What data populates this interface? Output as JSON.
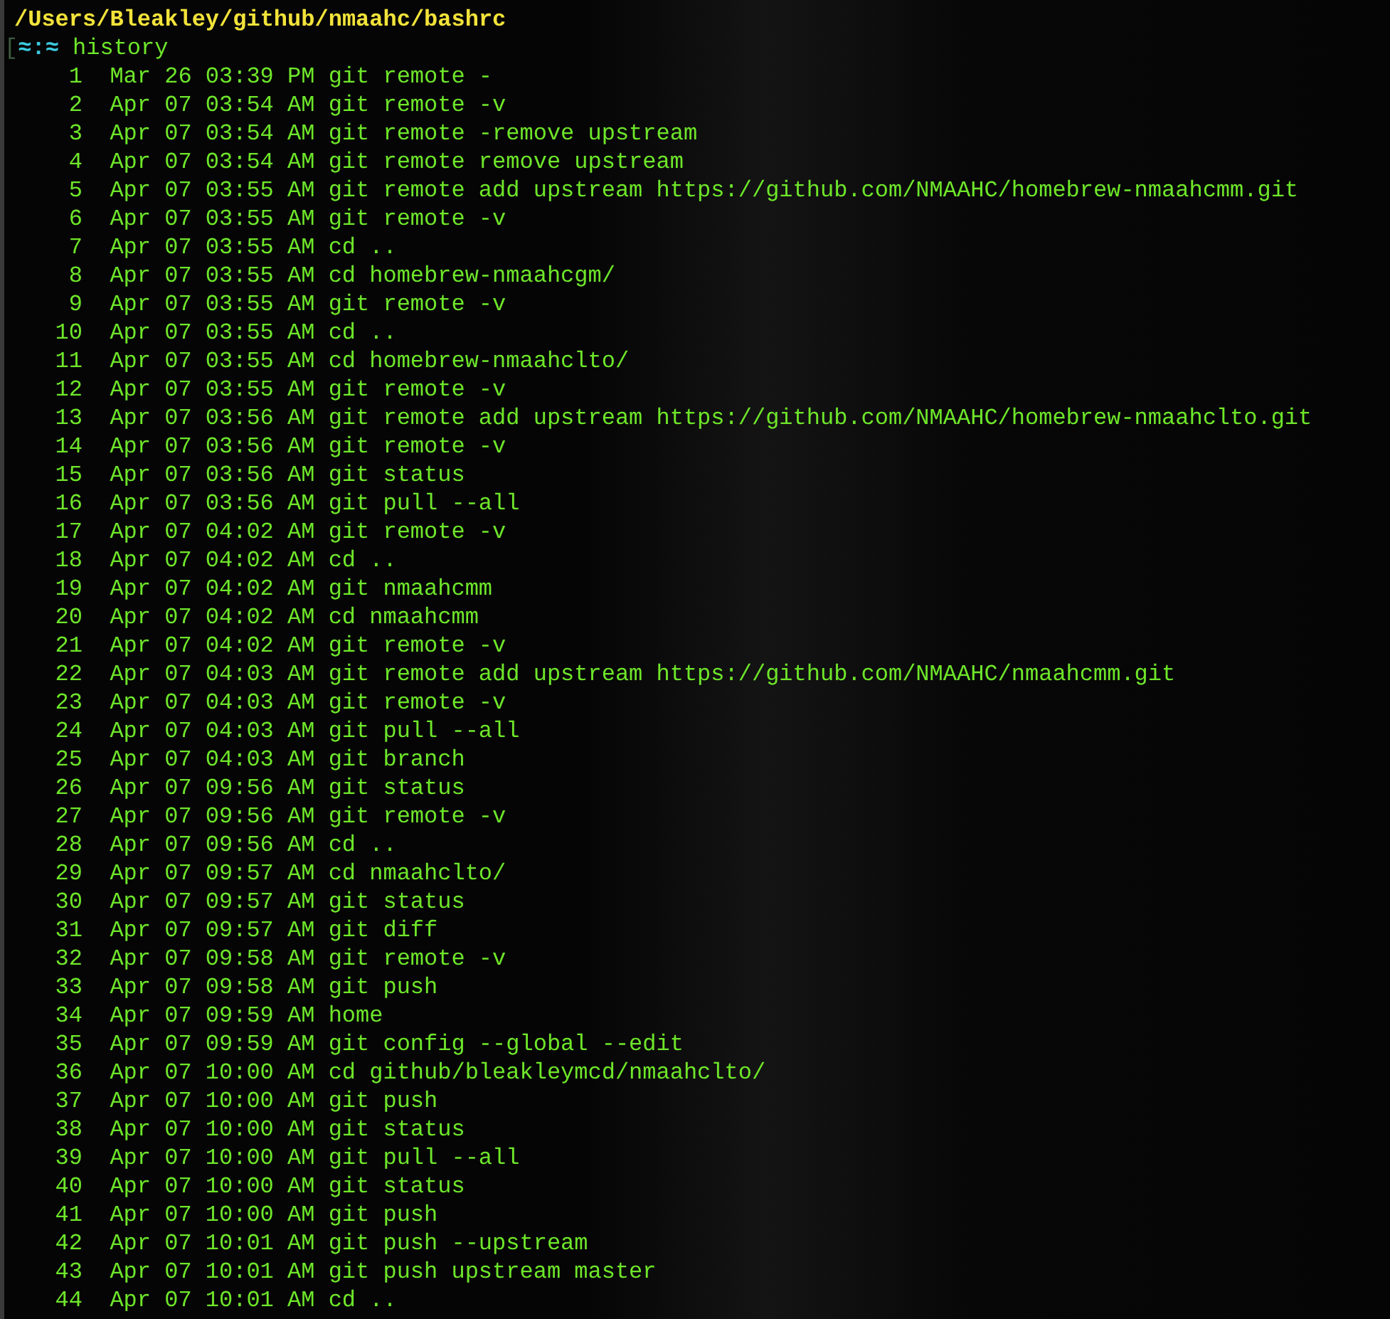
{
  "title": "/Users/Bleakley/github/nmaahc/bashrc",
  "prompt": {
    "bracket": "[",
    "symbol": "≈:≈",
    "command": "history"
  },
  "history": [
    {
      "number": "1",
      "timestamp": "Mar 26 03:39 PM",
      "command": "git remote -"
    },
    {
      "number": "2",
      "timestamp": "Apr 07 03:54 AM",
      "command": "git remote -v"
    },
    {
      "number": "3",
      "timestamp": "Apr 07 03:54 AM",
      "command": "git remote -remove upstream"
    },
    {
      "number": "4",
      "timestamp": "Apr 07 03:54 AM",
      "command": "git remote remove upstream"
    },
    {
      "number": "5",
      "timestamp": "Apr 07 03:55 AM",
      "command": "git remote add upstream https://github.com/NMAAHC/homebrew-nmaahcmm.git"
    },
    {
      "number": "6",
      "timestamp": "Apr 07 03:55 AM",
      "command": "git remote -v"
    },
    {
      "number": "7",
      "timestamp": "Apr 07 03:55 AM",
      "command": "cd .."
    },
    {
      "number": "8",
      "timestamp": "Apr 07 03:55 AM",
      "command": "cd homebrew-nmaahcgm/"
    },
    {
      "number": "9",
      "timestamp": "Apr 07 03:55 AM",
      "command": "git remote -v"
    },
    {
      "number": "10",
      "timestamp": "Apr 07 03:55 AM",
      "command": "cd .."
    },
    {
      "number": "11",
      "timestamp": "Apr 07 03:55 AM",
      "command": "cd homebrew-nmaahclto/"
    },
    {
      "number": "12",
      "timestamp": "Apr 07 03:55 AM",
      "command": "git remote -v"
    },
    {
      "number": "13",
      "timestamp": "Apr 07 03:56 AM",
      "command": "git remote add upstream https://github.com/NMAAHC/homebrew-nmaahclto.git"
    },
    {
      "number": "14",
      "timestamp": "Apr 07 03:56 AM",
      "command": "git remote -v"
    },
    {
      "number": "15",
      "timestamp": "Apr 07 03:56 AM",
      "command": "git status"
    },
    {
      "number": "16",
      "timestamp": "Apr 07 03:56 AM",
      "command": "git pull --all"
    },
    {
      "number": "17",
      "timestamp": "Apr 07 04:02 AM",
      "command": "git remote -v"
    },
    {
      "number": "18",
      "timestamp": "Apr 07 04:02 AM",
      "command": "cd .."
    },
    {
      "number": "19",
      "timestamp": "Apr 07 04:02 AM",
      "command": "git nmaahcmm"
    },
    {
      "number": "20",
      "timestamp": "Apr 07 04:02 AM",
      "command": "cd nmaahcmm"
    },
    {
      "number": "21",
      "timestamp": "Apr 07 04:02 AM",
      "command": "git remote -v"
    },
    {
      "number": "22",
      "timestamp": "Apr 07 04:03 AM",
      "command": "git remote add upstream https://github.com/NMAAHC/nmaahcmm.git"
    },
    {
      "number": "23",
      "timestamp": "Apr 07 04:03 AM",
      "command": "git remote -v"
    },
    {
      "number": "24",
      "timestamp": "Apr 07 04:03 AM",
      "command": "git pull --all"
    },
    {
      "number": "25",
      "timestamp": "Apr 07 04:03 AM",
      "command": "git branch"
    },
    {
      "number": "26",
      "timestamp": "Apr 07 09:56 AM",
      "command": "git status"
    },
    {
      "number": "27",
      "timestamp": "Apr 07 09:56 AM",
      "command": "git remote -v"
    },
    {
      "number": "28",
      "timestamp": "Apr 07 09:56 AM",
      "command": "cd .."
    },
    {
      "number": "29",
      "timestamp": "Apr 07 09:57 AM",
      "command": "cd nmaahclto/"
    },
    {
      "number": "30",
      "timestamp": "Apr 07 09:57 AM",
      "command": "git status"
    },
    {
      "number": "31",
      "timestamp": "Apr 07 09:57 AM",
      "command": "git diff"
    },
    {
      "number": "32",
      "timestamp": "Apr 07 09:58 AM",
      "command": "git remote -v"
    },
    {
      "number": "33",
      "timestamp": "Apr 07 09:58 AM",
      "command": "git push"
    },
    {
      "number": "34",
      "timestamp": "Apr 07 09:59 AM",
      "command": "home"
    },
    {
      "number": "35",
      "timestamp": "Apr 07 09:59 AM",
      "command": "git config --global --edit"
    },
    {
      "number": "36",
      "timestamp": "Apr 07 10:00 AM",
      "command": "cd github/bleakleymcd/nmaahclto/"
    },
    {
      "number": "37",
      "timestamp": "Apr 07 10:00 AM",
      "command": "git push"
    },
    {
      "number": "38",
      "timestamp": "Apr 07 10:00 AM",
      "command": "git status"
    },
    {
      "number": "39",
      "timestamp": "Apr 07 10:00 AM",
      "command": "git pull --all"
    },
    {
      "number": "40",
      "timestamp": "Apr 07 10:00 AM",
      "command": "git status"
    },
    {
      "number": "41",
      "timestamp": "Apr 07 10:00 AM",
      "command": "git push"
    },
    {
      "number": "42",
      "timestamp": "Apr 07 10:01 AM",
      "command": "git push --upstream"
    },
    {
      "number": "43",
      "timestamp": "Apr 07 10:01 AM",
      "command": "git push upstream master"
    },
    {
      "number": "44",
      "timestamp": "Apr 07 10:01 AM",
      "command": "cd .."
    }
  ]
}
